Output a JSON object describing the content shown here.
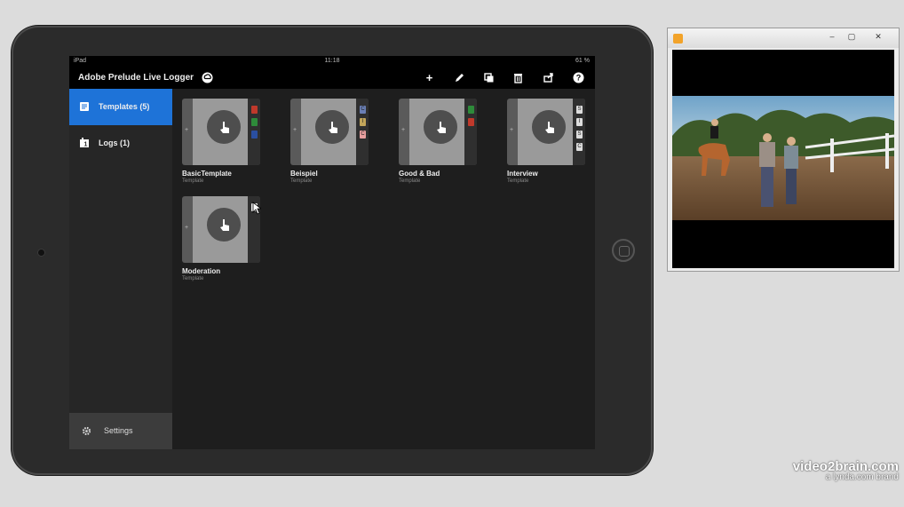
{
  "status_bar": {
    "device": "iPad",
    "time": "11:18",
    "battery": "61 %"
  },
  "app": {
    "title": "Adobe Prelude Live Logger"
  },
  "toolbar": {
    "icons": [
      "plus-icon",
      "pencil-icon",
      "duplicate-icon",
      "trash-icon",
      "share-icon",
      "help-icon"
    ]
  },
  "sidebar": {
    "items": [
      {
        "label": "Templates (5)",
        "active": true
      },
      {
        "label": "Logs (1)",
        "active": false
      }
    ],
    "settings_label": "Settings"
  },
  "templates": [
    {
      "name": "BasicTemplate",
      "type": "Template",
      "markers": [
        "#c0392b",
        "#2e8b3a",
        "#2a4fa0"
      ],
      "marker_text": [
        "",
        "",
        ""
      ]
    },
    {
      "name": "Beispiel",
      "type": "Template",
      "markers": [
        "#6a7fb5",
        "#c2a55a",
        "#e9a0a0"
      ],
      "marker_text": [
        "C",
        "I",
        "C"
      ]
    },
    {
      "name": "Good & Bad",
      "type": "Template",
      "markers": [
        "#2e8b3a",
        "#c0392b"
      ],
      "marker_text": [
        "",
        ""
      ]
    },
    {
      "name": "Interview",
      "type": "Template",
      "markers": [
        "#dddddd",
        "#dddddd",
        "#dddddd",
        "#dddddd"
      ],
      "marker_text": [
        "S",
        "I",
        "S",
        "C"
      ]
    },
    {
      "name": "Moderation",
      "type": "Template",
      "markers": [
        "#eeeeee"
      ],
      "marker_text": [
        ""
      ]
    }
  ],
  "watermark": {
    "brand": "video2brain.com",
    "sub": "a lynda.com brand"
  }
}
